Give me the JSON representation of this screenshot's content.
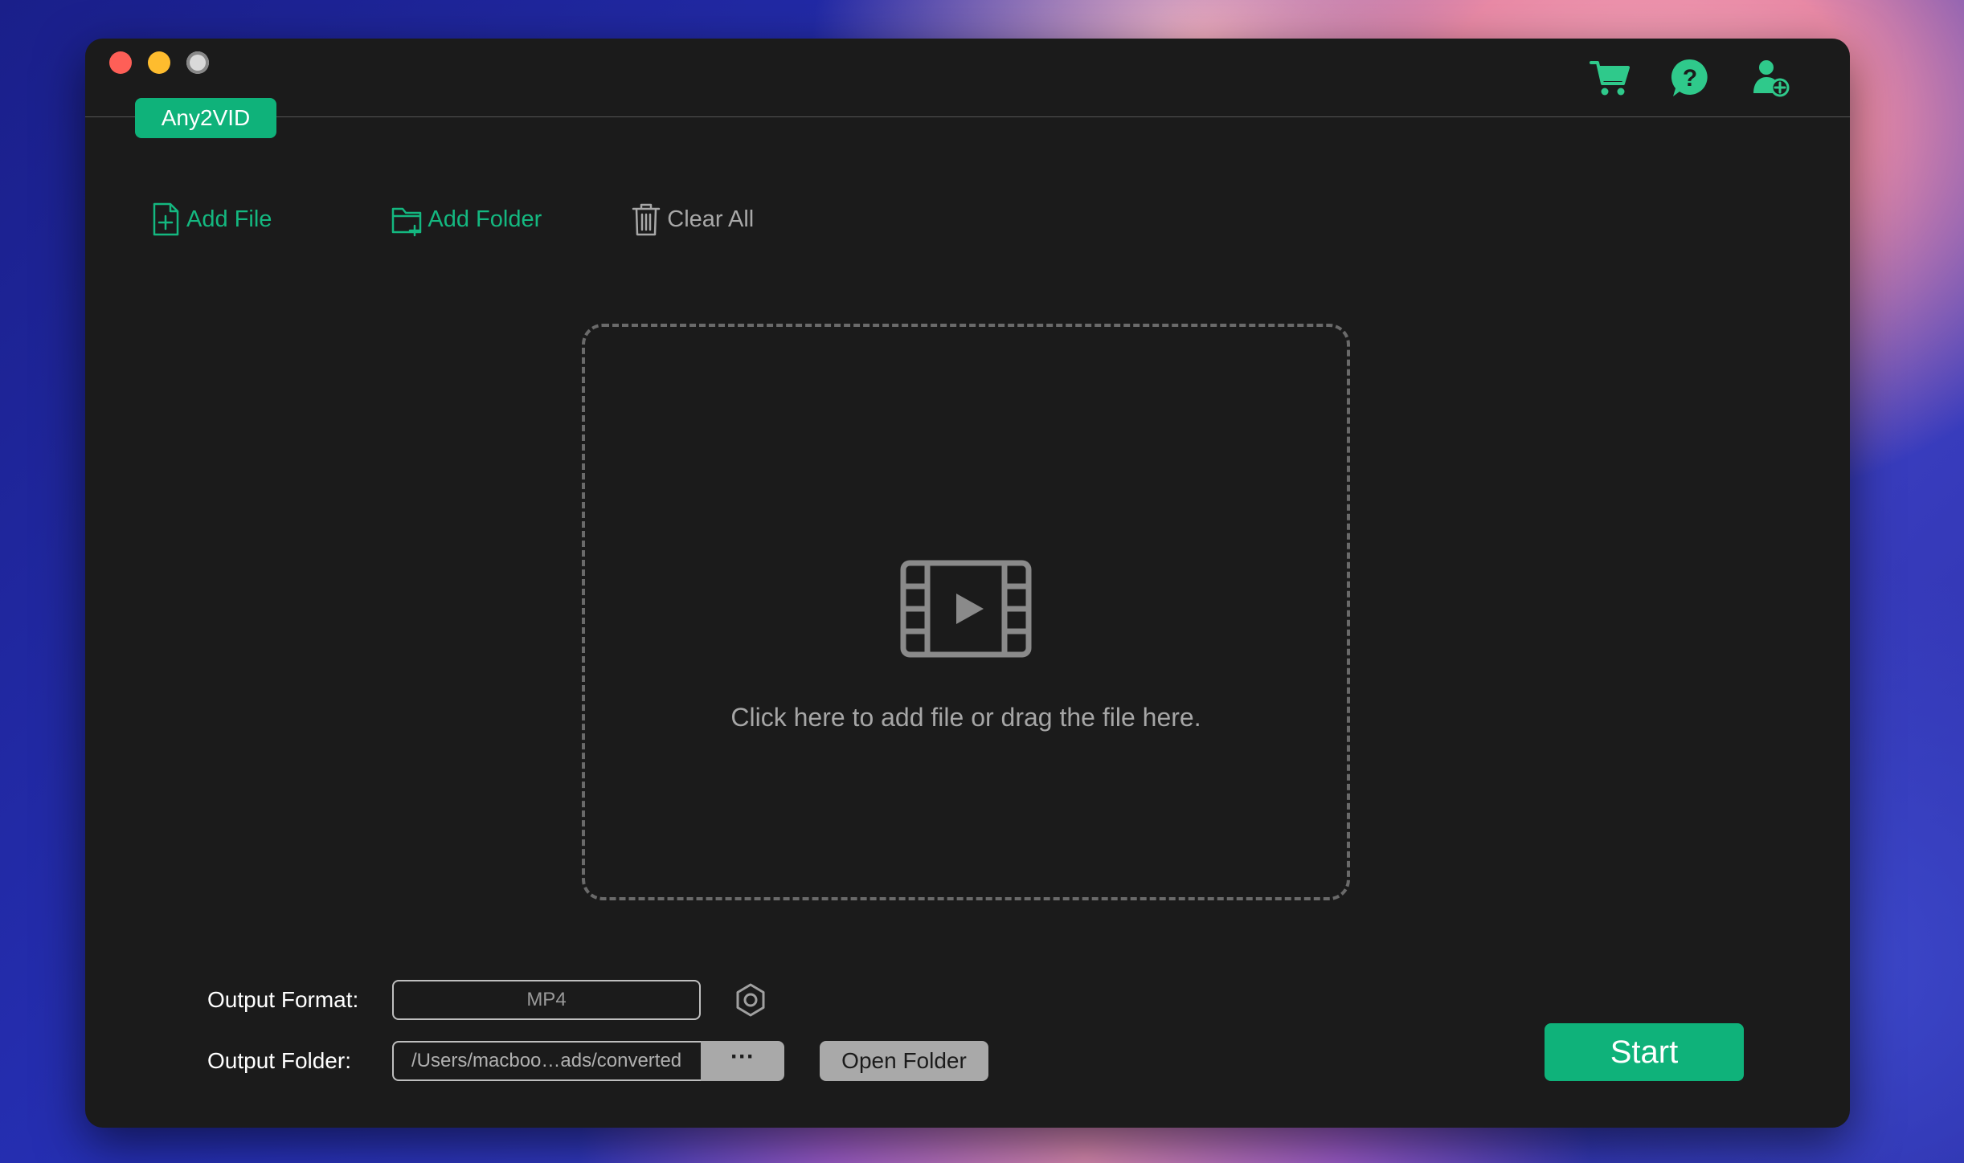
{
  "app": {
    "tab_label": "Any2VID"
  },
  "colors": {
    "accent": "#0fb27a",
    "window_bg": "#1b1b1b",
    "muted_text": "#a6a6a6"
  },
  "header_icons": [
    "cart-icon",
    "help-icon",
    "user-add-icon"
  ],
  "toolbar": {
    "add_file": "Add File",
    "add_folder": "Add Folder",
    "clear_all": "Clear All"
  },
  "dropzone": {
    "icon": "film-icon",
    "text": "Click here to add file or drag the file here."
  },
  "output": {
    "format_label": "Output Format:",
    "format_value": "MP4",
    "folder_label": "Output Folder:",
    "folder_value": "/Users/macboo…ads/converted",
    "browse_label": "···",
    "open_folder": "Open Folder"
  },
  "actions": {
    "start": "Start"
  }
}
